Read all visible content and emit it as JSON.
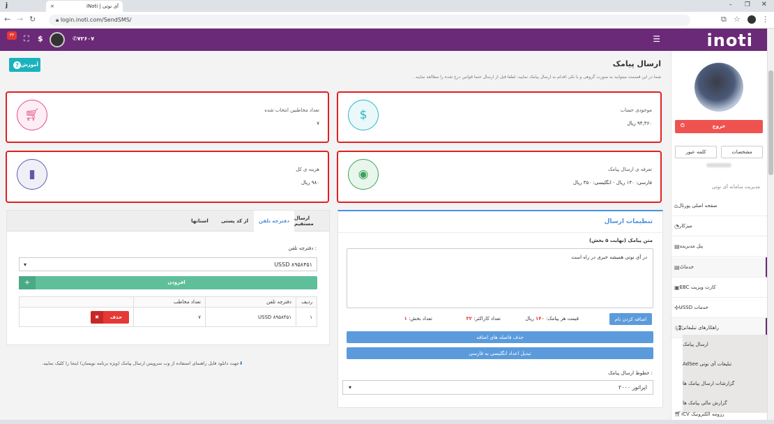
{
  "browser": {
    "tab_title": "iNoti | آی نوتی",
    "tab_close": "×",
    "url": "login.inoti.com/SendSMS/",
    "profile_letter": "j"
  },
  "topbar": {
    "logo": "inoti",
    "phone": "۷۲۶۰۷",
    "badge": "۳۳",
    "accent": "#6a2a77"
  },
  "page": {
    "title": "ارسال پیامک",
    "subtitle": "شما در این قسمت میتوانید به صورت گروهی و یا تکی اقدام به ارسال پیامک نمایید، لطفا قبل از ارسال حتما قوانین درج شده را مطالعه نمایید .",
    "help_button": "آموزش"
  },
  "cards": {
    "balance": {
      "title": "موجودی حساب",
      "value": "۹۴,۳۶۰ ریال",
      "icon": "dollar-icon",
      "color": "#29b6c6"
    },
    "selected": {
      "title": "تعداد مخاطبین انتخاب شده",
      "value": "۷",
      "icon": "cart-icon",
      "color": "#e04b8a"
    },
    "tariff": {
      "title": "تعرفه ی ارسال پیامک",
      "value": "فارسی: ۱۴۰ ریال - انگلیسی: ۳۵۰ ریال",
      "icon": "eye-icon",
      "color": "#3aa35b"
    },
    "cost": {
      "title": "هزینه ی کل",
      "value": "۹۸۰ ریال",
      "icon": "bar-chart-icon",
      "color": "#5c5aa8"
    }
  },
  "settings": {
    "title": "تنظیمات ارسال",
    "message_label": "متن پیامک (نهایت ۵ بخش)",
    "message_text": "در آی نوتی همیشه خبری در راه است",
    "add_name_button": "اضافه کردن نام",
    "price_label": "قیمت هر پیامک:",
    "price_value": "۱۴۰",
    "price_unit": "ریال",
    "chars_label": "تعداد کاراکتر:",
    "chars_value": "۳۲",
    "parts_label": "تعداد بخش:",
    "parts_value": "۱",
    "remove_spaces_button": "حذف فاصله های اضافه",
    "convert_digits_button": "تبدیل اعداد انگلیسی به فارسی",
    "line_label": "خطوط ارسال پیامک :",
    "line_value": "اپراتور ۲۰۰۰"
  },
  "recipients": {
    "tabs": [
      "ارسال مستقیم",
      "دفترچه تلفن",
      "از کد پستی",
      "استانها"
    ],
    "active_tab": 1,
    "phonebook_label": "دفترچه تلفن :",
    "phonebook_value": "USSD ۸۹۵۸۴۵۱",
    "add_button": "افزودن",
    "add_plus": "+",
    "table": {
      "headers": [
        "ردیف",
        "دفترچه تلفن",
        "تعداد مخاطب",
        ""
      ],
      "rows": [
        [
          "۱",
          "USSD ۸۹۵۸۴۵۱",
          "۷",
          "حذف"
        ]
      ]
    },
    "delete_x": "✖"
  },
  "download_note": "جهت دانلود فایل راهنمای استفاده از وب سرویس ارسال پیامک (ویژه برنامه نویسان) اینجا را کلیک نمایید.",
  "sidebar": {
    "logout": "خروج",
    "profile_button": "مشخصات",
    "password_button": "کلمه عبور",
    "username_blur": "",
    "section_title": "مدیریت سامانه آی نوتی",
    "items": [
      {
        "label": "صفحه اصلی پورتال",
        "icon": "home-icon",
        "chevron": ""
      },
      {
        "label": "میزکار",
        "icon": "dashboard-icon",
        "chevron": ""
      },
      {
        "label": "پنل مدیریت",
        "icon": "panel-icon",
        "chevron": "‹"
      },
      {
        "label": "خدمات",
        "icon": "services-icon",
        "chevron": "⌃"
      },
      {
        "label": "کارت ویزیت EBC",
        "icon": "card-icon",
        "chevron": "‹"
      },
      {
        "label": "خدمات USSD",
        "icon": "ussd-icon",
        "chevron": "‹"
      },
      {
        "label": "راهکارهای تبلیغاتی",
        "icon": "megaphone-icon",
        "chevron": "⌃"
      }
    ],
    "subitems": [
      "ارسال پیامک",
      "تبلیغات آی نوتی AdSee",
      "گزارشات ارسال پیامک ها",
      "گزارش مالی پیامک ها"
    ],
    "last_item": "رزومه الکترونیک iCV"
  }
}
